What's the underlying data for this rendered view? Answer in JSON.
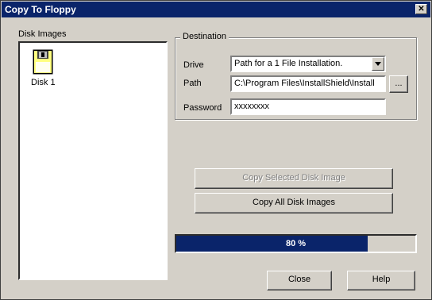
{
  "window": {
    "title": "Copy To Floppy",
    "close_glyph": "✕"
  },
  "disk_images": {
    "label": "Disk Images",
    "items": [
      {
        "label": "Disk 1",
        "icon": "floppy-disk-icon"
      }
    ]
  },
  "destination": {
    "group_label": "Destination",
    "drive": {
      "label": "Drive",
      "value": "Path for a 1 File Installation."
    },
    "path": {
      "label": "Path",
      "value": "C:\\Program Files\\InstallShield\\Install",
      "browse_label": "..."
    },
    "password": {
      "label": "Password",
      "value": "xxxxxxxx"
    }
  },
  "actions": {
    "copy_selected": "Copy Selected Disk Image",
    "copy_all": "Copy All Disk Images"
  },
  "progress": {
    "percent": 80,
    "text": "80 %"
  },
  "buttons": {
    "close": "Close",
    "help": "Help"
  }
}
